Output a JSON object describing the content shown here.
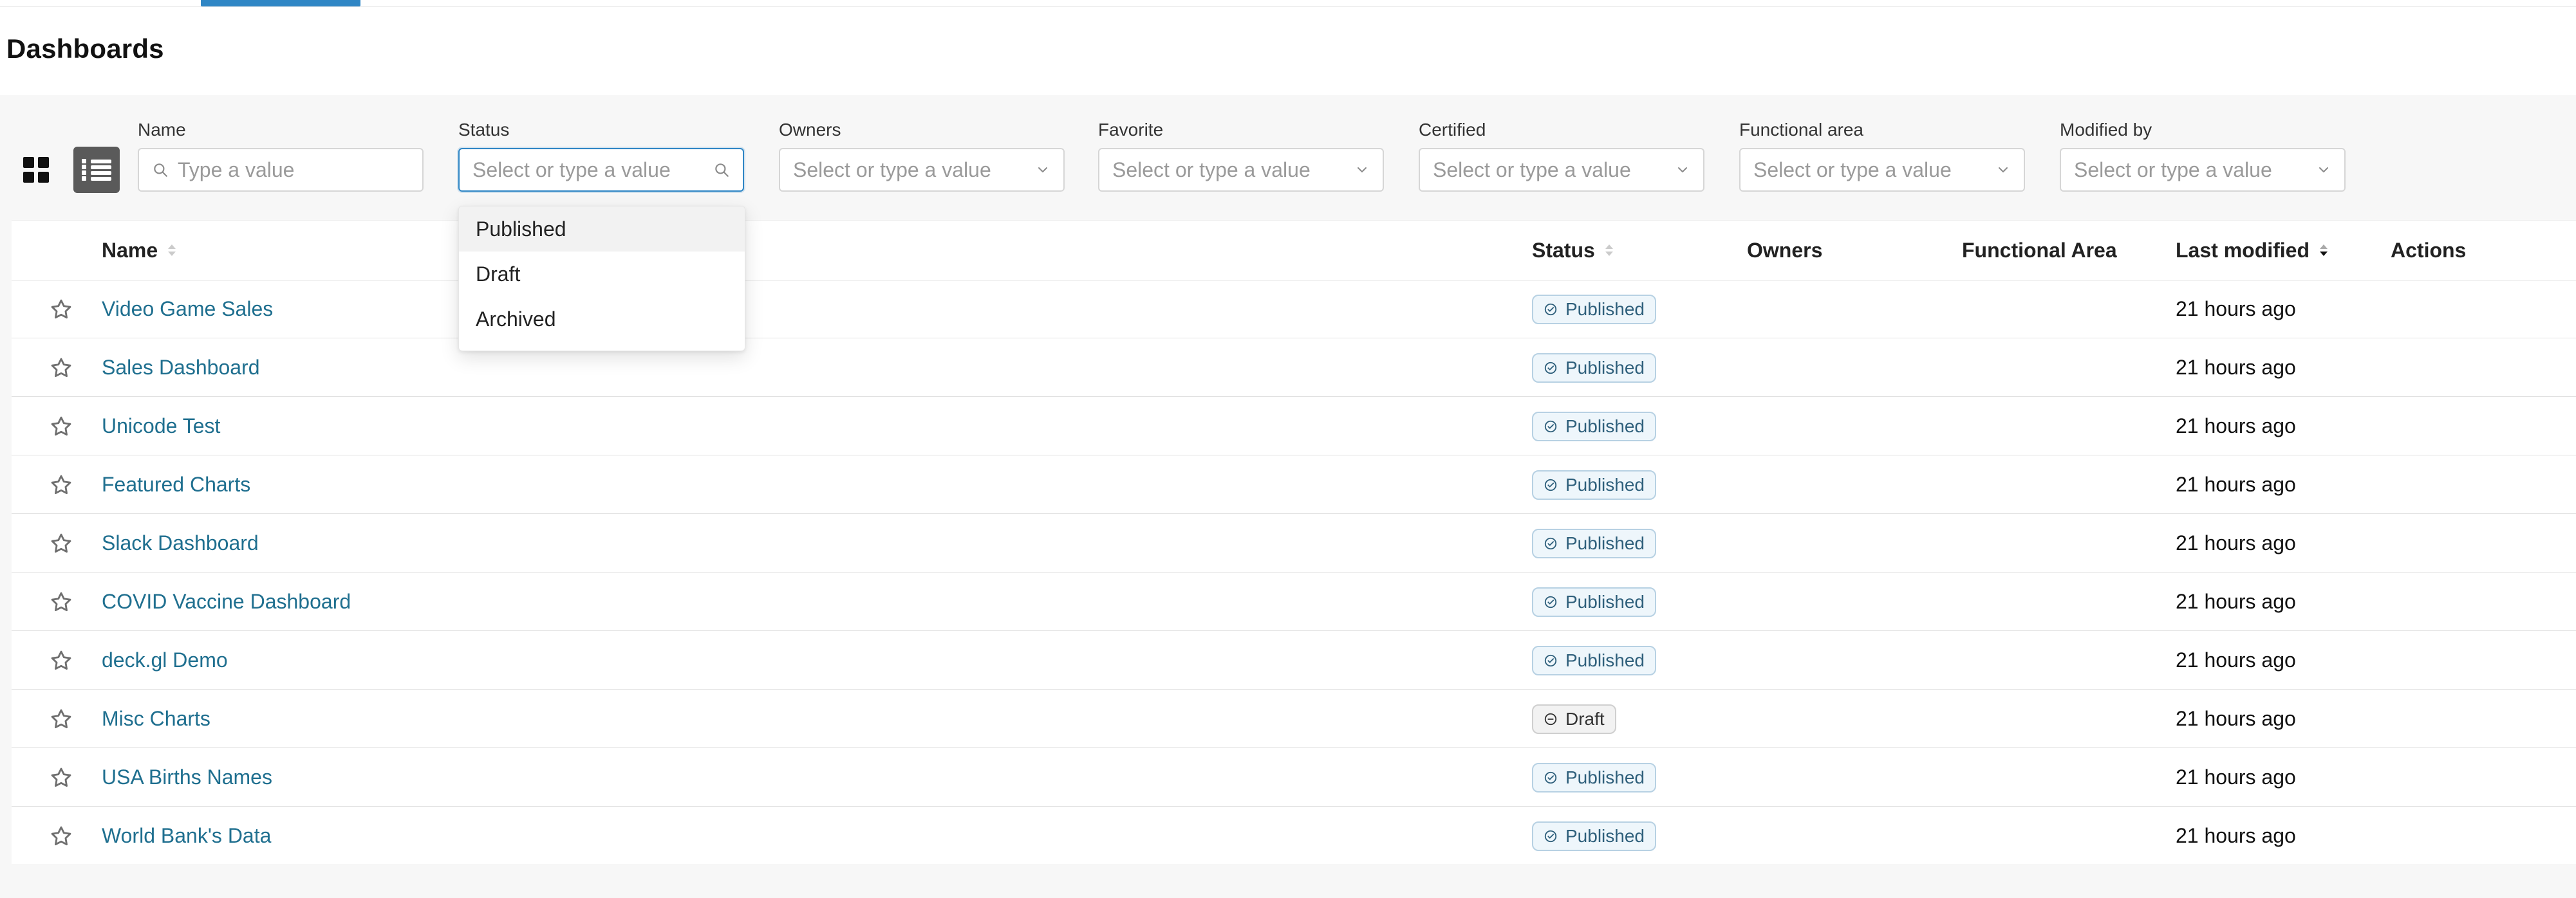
{
  "page": {
    "title": "Dashboards"
  },
  "view_toggle": {
    "grid_icon": "grid-view-icon",
    "list_icon": "list-view-icon"
  },
  "filters": {
    "name": {
      "label": "Name",
      "placeholder": "Type a value",
      "icon": "search-icon"
    },
    "status": {
      "label": "Status",
      "placeholder": "Select or type a value",
      "icon": "search-icon",
      "open": true,
      "options": [
        "Published",
        "Draft",
        "Archived"
      ]
    },
    "owners": {
      "label": "Owners",
      "placeholder": "Select or type a value",
      "icon": "chevron-down-icon"
    },
    "favorite": {
      "label": "Favorite",
      "placeholder": "Select or type a value",
      "icon": "chevron-down-icon"
    },
    "certified": {
      "label": "Certified",
      "placeholder": "Select or type a value",
      "icon": "chevron-down-icon"
    },
    "functional_area": {
      "label": "Functional area",
      "placeholder": "Select or type a value",
      "icon": "chevron-down-icon"
    },
    "modified_by": {
      "label": "Modified by",
      "placeholder": "Select or type a value",
      "icon": "chevron-down-icon"
    }
  },
  "table": {
    "headers": {
      "name": "Name",
      "status": "Status",
      "owners": "Owners",
      "functional_area": "Functional Area",
      "last_modified": "Last modified",
      "actions": "Actions"
    },
    "rows": [
      {
        "name": "Video Game Sales",
        "status": "Published",
        "last_modified": "21 hours ago"
      },
      {
        "name": "Sales Dashboard",
        "status": "Published",
        "last_modified": "21 hours ago"
      },
      {
        "name": "Unicode Test",
        "status": "Published",
        "last_modified": "21 hours ago"
      },
      {
        "name": "Featured Charts",
        "status": "Published",
        "last_modified": "21 hours ago"
      },
      {
        "name": "Slack Dashboard",
        "status": "Published",
        "last_modified": "21 hours ago"
      },
      {
        "name": "COVID Vaccine Dashboard",
        "status": "Published",
        "last_modified": "21 hours ago"
      },
      {
        "name": "deck.gl Demo",
        "status": "Published",
        "last_modified": "21 hours ago"
      },
      {
        "name": "Misc Charts",
        "status": "Draft",
        "last_modified": "21 hours ago"
      },
      {
        "name": "USA Births Names",
        "status": "Published",
        "last_modified": "21 hours ago"
      },
      {
        "name": "World Bank's Data",
        "status": "Published",
        "last_modified": "21 hours ago"
      }
    ]
  },
  "colors": {
    "accent": "#2f86c5",
    "link": "#1f6f8f",
    "published_badge_bg": "#eef6fb",
    "published_badge_border": "#b7d1e3",
    "draft_badge_bg": "#f2f2f2",
    "draft_badge_border": "#cfcfcf"
  }
}
